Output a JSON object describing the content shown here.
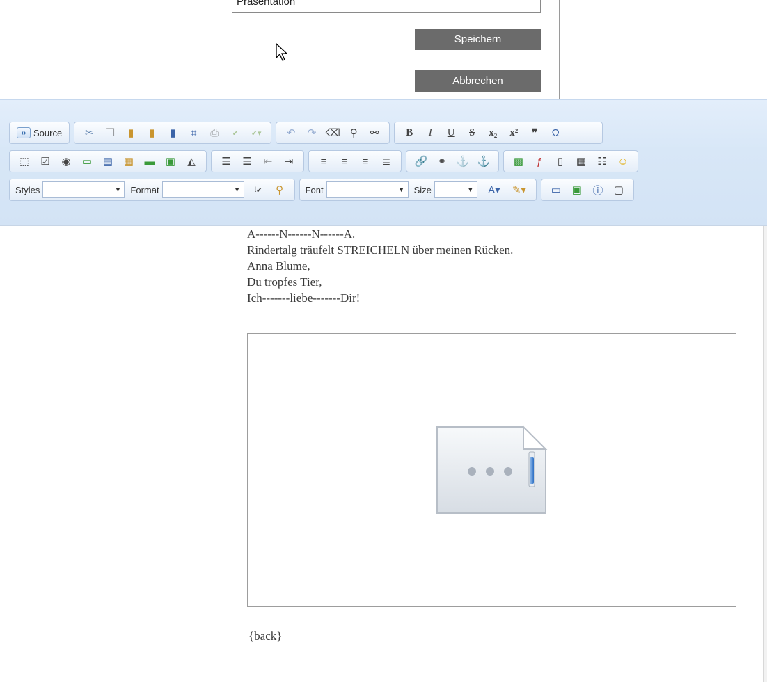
{
  "dialog": {
    "field_value": "Präsentation",
    "save_label": "Speichern",
    "cancel_label": "Abbrechen"
  },
  "toolbar": {
    "source_label": "Source",
    "styles_label": "Styles",
    "format_label": "Format",
    "font_label": "Font",
    "size_label": "Size",
    "row1_icons": [
      "cut-icon",
      "copy-icon",
      "paste-icon",
      "paste-text-icon",
      "paste-word-icon",
      "select-all-icon",
      "print-icon",
      "spellcheck-icon",
      "spellcheck-dropdown-icon",
      "undo-icon",
      "redo-icon",
      "remove-format-icon",
      "find-icon",
      "replace-icon",
      "bold-icon",
      "italic-icon",
      "underline-icon",
      "strikethrough-icon",
      "subscript-icon",
      "superscript-icon",
      "blockquote-icon",
      "special-char-icon"
    ],
    "row2_icons": [
      "form-icon",
      "checkbox-icon",
      "radio-icon",
      "textfield-icon",
      "textarea-icon",
      "select-icon",
      "button-icon",
      "image-button-icon",
      "hidden-field-icon",
      "numbered-list-icon",
      "bulleted-list-icon",
      "outdent-icon",
      "indent-icon",
      "align-left-icon",
      "align-center-icon",
      "align-right-icon",
      "justify-icon",
      "link-icon",
      "unlink-icon",
      "anchor-icon",
      "image-icon",
      "flash-icon",
      "page-break-icon",
      "table-icon",
      "horizontal-rule-icon",
      "smiley-icon"
    ],
    "row3_icons": [
      "font-color-icon",
      "background-color-icon",
      "maximize-icon",
      "show-blocks-icon",
      "about-icon",
      "iframe-icon"
    ]
  },
  "content": {
    "poem_lines": [
      "A------N------N------A.",
      "Rindertalg träufelt STREICHELN über meinen Rücken.",
      "Anna Blume,",
      "Du tropfes Tier,",
      "Ich-------liebe-------Dir!"
    ],
    "back_text": "{back}"
  }
}
